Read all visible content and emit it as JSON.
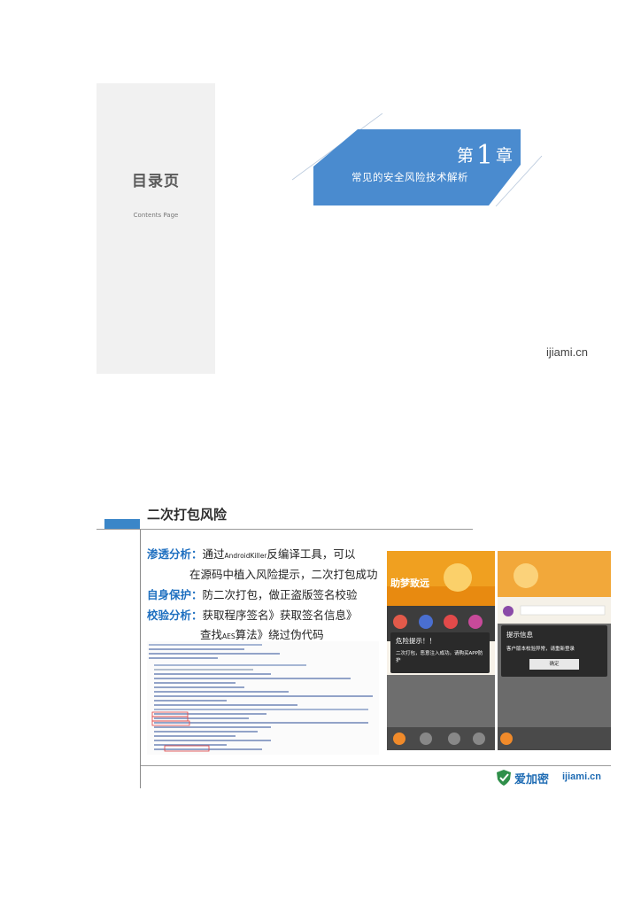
{
  "slide1": {
    "toc_title": "目录页",
    "toc_subtitle": "Contents Page",
    "chapter_prefix": "第",
    "chapter_number": "1",
    "chapter_suffix": "章",
    "chapter_title": "常见的安全风险技术解析",
    "brand": "ijiami.cn",
    "accent_color": "#4a8bcf"
  },
  "slide2": {
    "title": "二次打包风险",
    "lines": {
      "l1_label": "渗透分析：",
      "l1_text_a": "通过",
      "l1_small": "AndroidKiller",
      "l1_text_b": "反编译工具，可以",
      "l2_text": "在源码中植入风险提示，二次打包成功",
      "l3_label": "自身保护：",
      "l3_text": "防二次打包，做正盗版签名校验",
      "l4_label": "校验分析：",
      "l4_text": "获取程序签名》获取签名信息》",
      "l5_text_a": "查找",
      "l5_small": "AES",
      "l5_text_b": "算法》绕过伪代码"
    },
    "phone1": {
      "banner_text": "助梦致远",
      "dialog_title": "危险提示！！",
      "dialog_body": "二次打包，恶意注入成功。请购买APP防护"
    },
    "phone2": {
      "dialog_title": "提示信息",
      "dialog_body": "客户版本校验异常，请重新登录",
      "dialog_button": "确定"
    },
    "logo_cn": "爱加密",
    "logo_en": "ijiami.cn",
    "accent_color": "#3a86c8"
  }
}
